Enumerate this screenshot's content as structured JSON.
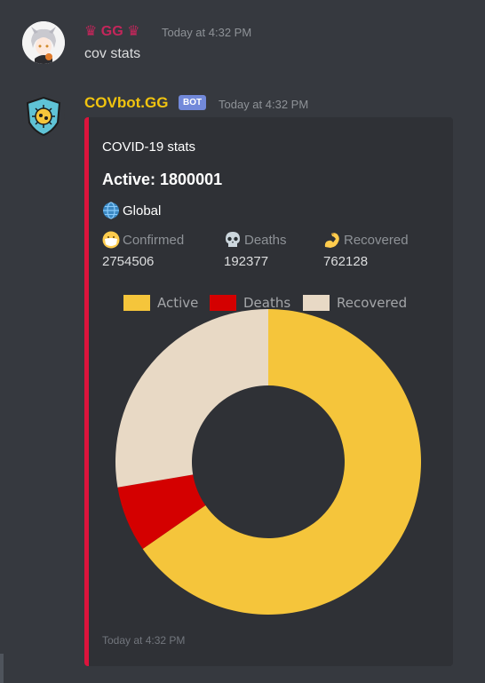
{
  "messages": [
    {
      "username": "♛ GG ♛",
      "username_color": "#c4265b",
      "timestamp": "Today at 4:32 PM",
      "content": "cov stats"
    },
    {
      "username": "COVbot.GG",
      "username_color": "#f1c40f",
      "bot_tag": "BOT",
      "timestamp": "Today at 4:32 PM",
      "embed": {
        "accent_color": "#dc143c",
        "title": "COVID-19 stats",
        "active": "Active: 1800001",
        "region": "Global",
        "fields": [
          {
            "icon": "mask-face-icon",
            "name": "Confirmed",
            "value": "2754506"
          },
          {
            "icon": "skull-icon",
            "name": "Deaths",
            "value": "192377"
          },
          {
            "icon": "flexed-biceps-icon",
            "name": "Recovered",
            "value": "762128"
          }
        ],
        "footer": "Today at 4:32 PM"
      }
    }
  ],
  "chart_data": {
    "type": "pie",
    "donut": true,
    "categories": [
      "Active",
      "Deaths",
      "Recovered"
    ],
    "values": [
      1800001,
      192377,
      762128
    ],
    "colors": [
      "#f5c53b",
      "#d40000",
      "#e8d9c5"
    ],
    "legend_position": "top"
  }
}
